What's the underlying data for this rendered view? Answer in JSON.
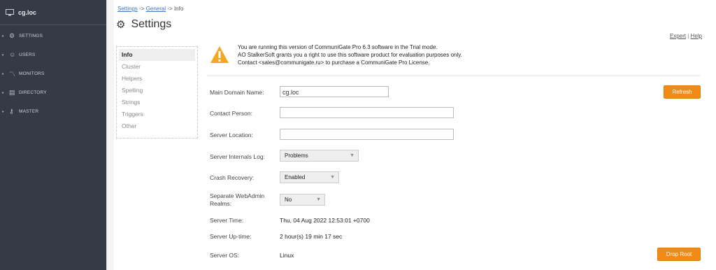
{
  "sidebar": {
    "host": "cg.loc",
    "items": [
      {
        "label": "SETTINGS",
        "icon": "gear-icon"
      },
      {
        "label": "USERS",
        "icon": "user-icon"
      },
      {
        "label": "MONITORS",
        "icon": "chart-icon"
      },
      {
        "label": "DIRECTORY",
        "icon": "directory-icon"
      },
      {
        "label": "MASTER",
        "icon": "key-icon"
      }
    ]
  },
  "breadcrumb": {
    "settings": "Settings",
    "sep1": " -> ",
    "general": "General",
    "sep2": " -> Info"
  },
  "page": {
    "title": "Settings"
  },
  "help_links": {
    "expert": "Expert",
    "sep": " | ",
    "help": "Help"
  },
  "tabs": [
    "Info",
    "Cluster",
    "Helpers",
    "Spelling",
    "Strings",
    "Triggers",
    "Other"
  ],
  "notice": {
    "line1": "You are running this version of CommuniGate Pro 6.3 software in the Trial mode.",
    "line2": "AO StalkerSoft grants you a right to use this software product for evaluation purposes only.",
    "line3": "Contact <sales@communigate.ru> to purchase a CommuniGate Pro License."
  },
  "form": {
    "main_domain_label": "Main Domain Name:",
    "main_domain_value": "cg.loc",
    "contact_person_label": "Contact Person:",
    "contact_person_value": "",
    "server_location_label": "Server Location:",
    "server_location_value": "",
    "internals_log_label": "Server Internals Log:",
    "internals_log_value": "Problems",
    "crash_recovery_label": "Crash Recovery:",
    "crash_recovery_value": "Enabled",
    "separate_realms_label_1": "Separate WebAdmin",
    "separate_realms_label_2": "Realms:",
    "separate_realms_value": "No",
    "server_time_label": "Server Time:",
    "server_time_value": "Thu, 04 Aug 2022 12:53:01 +0700",
    "uptime_label": "Server Up-time:",
    "uptime_value": "2 hour(s) 19 min 17 sec",
    "os_label": "Server OS:",
    "os_value": "Linux"
  },
  "buttons": {
    "refresh": "Refresh",
    "drop_root": "Drop Root"
  },
  "colors": {
    "sidebar_bg": "#343a46",
    "accent": "#f28a16",
    "warning": "#f5a623"
  }
}
